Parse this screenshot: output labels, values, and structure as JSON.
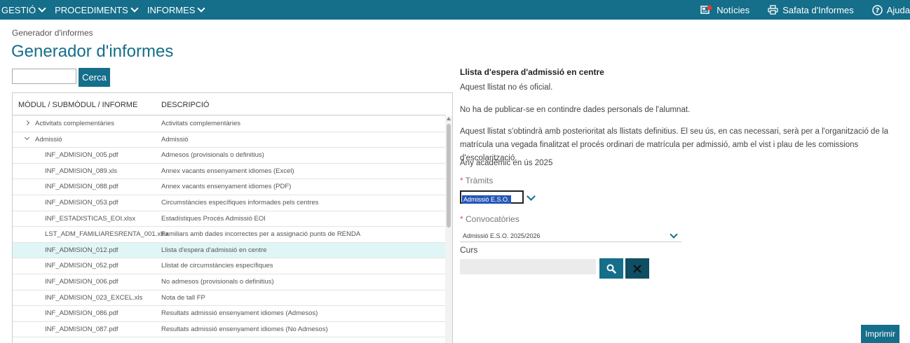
{
  "topbar": {
    "menu": [
      "GESTIÓ",
      "PROCEDIMENTS",
      "INFORMES"
    ],
    "links": {
      "news": "Notícies",
      "reports_tray": "Safata d'Informes",
      "help": "Ajuda"
    }
  },
  "breadcrumb": "Generador d'informes",
  "page_title": "Generador d'informes",
  "search": {
    "value": "",
    "button": "Cerca"
  },
  "table": {
    "headers": [
      "MÒDUL / SUBMÒDUL / INFORME",
      "DESCRIPCIÓ"
    ],
    "rows": [
      {
        "name": "Activitats complementàries",
        "desc": "Activitats complementàries"
      },
      {
        "name": "Admissió",
        "desc": "Admissió"
      },
      {
        "name": "INF_ADMISION_005.pdf",
        "desc": "Admesos (provisionals o definitius)"
      },
      {
        "name": "INF_ADMISION_089.xls",
        "desc": "Annex vacants ensenyament idiomes (Excel)"
      },
      {
        "name": "INF_ADMISION_088.pdf",
        "desc": "Annex vacants ensenyament idiomes (PDF)"
      },
      {
        "name": "INF_ADMISION_053.pdf",
        "desc": "Circumstàncies específiques informades pels centres"
      },
      {
        "name": "INF_ESTADISTICAS_EOI.xlsx",
        "desc": "Estadístiques Procés Admissió EOI"
      },
      {
        "name": "LST_ADM_FAMILIARESRENTA_001.xlsx",
        "desc": "Familiars amb dades incorrectes per a assignació punts de RENDA"
      },
      {
        "name": "INF_ADMISION_012.pdf",
        "desc": "Llista d'espera d'admissió en centre"
      },
      {
        "name": "INF_ADMISION_052.pdf",
        "desc": "Llistat de circumstàncies específiques"
      },
      {
        "name": "INF_ADMISION_006.pdf",
        "desc": "No admesos (provisionals o definitius)"
      },
      {
        "name": "INF_ADMISION_023_EXCEL.xls",
        "desc": "Nota de tall FP"
      },
      {
        "name": "INF_ADMISION_086.pdf",
        "desc": "Resultats admissió ensenyament idiomes (Admesos)"
      },
      {
        "name": "INF_ADMISION_087.pdf",
        "desc": "Resultats admissió ensenyament idiomes (No Admesos)"
      }
    ]
  },
  "detail": {
    "title": "Llista d'espera d'admissió en centre",
    "p1": "Aquest llistat no és oficial.",
    "p2": "No ha de publicar-se en contindre dades personals de l'alumnat.",
    "p3": "Aquest llistat s'obtindrà amb posterioritat als llistats definitius. El seu ús, en cas necessari, serà per a l'organització de la matrícula una vegada finalitzat el procés ordinari de matrícula per admissió, amb el vist i plau de les comissions d'escolarització.",
    "p4": "Any acadèmic en ús 2025",
    "required_mark": "*",
    "tramits_label": "Tràmits",
    "tramits_value": "Admissió E.S.O.",
    "conv_label": "Convocatòries",
    "conv_value": "Admissió E.S.O. 2025/2026",
    "curs_label": "Curs",
    "curs_value": "",
    "print_button": "Imprimir"
  },
  "colors": {
    "brand": "#156e8a",
    "selected_row": "#e0f6f6",
    "required": "#d9534f"
  }
}
